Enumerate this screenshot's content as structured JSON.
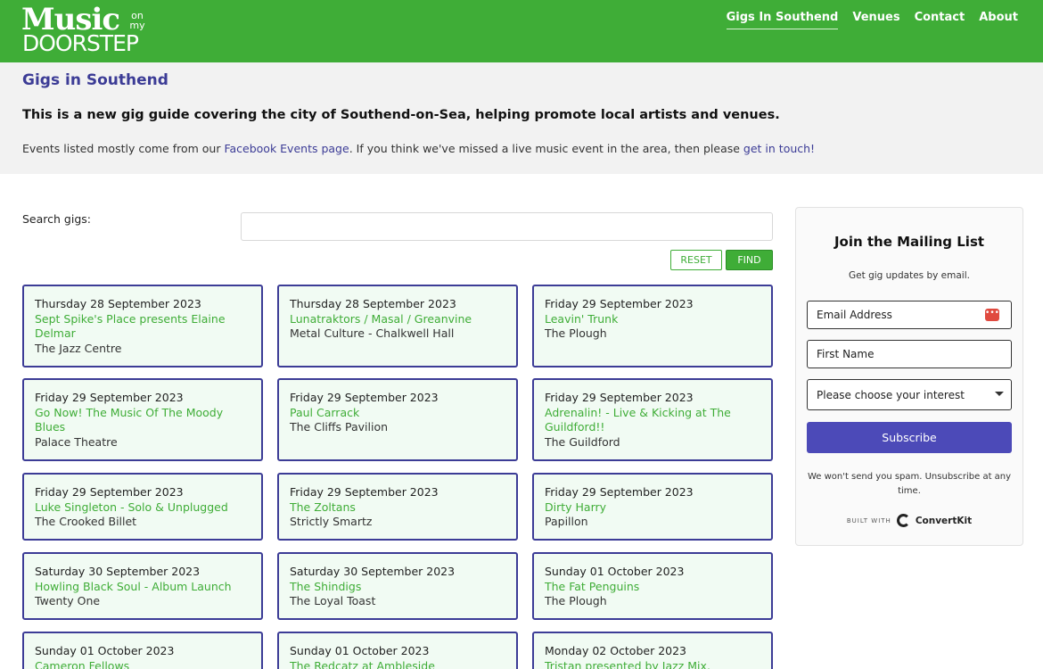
{
  "header": {
    "logo": {
      "line1": "Music",
      "line1_small": "on my",
      "line2": "DOORSTEP"
    },
    "nav": [
      {
        "label": "Gigs In Southend",
        "active": true
      },
      {
        "label": "Venues",
        "active": false
      },
      {
        "label": "Contact",
        "active": false
      },
      {
        "label": "About",
        "active": false
      }
    ]
  },
  "intro": {
    "title": "Gigs in Southend",
    "lead": "This is a new gig guide covering the city of Southend-on-Sea, helping promote local artists and venues.",
    "sub_pre": "Events listed mostly come from our ",
    "sub_link1": "Facebook Events page",
    "sub_mid": ". If you think we've missed a live music event in the area, then please ",
    "sub_link2": "get in touch!"
  },
  "search": {
    "label": "Search gigs:",
    "value": "",
    "reset_label": "RESET",
    "find_label": "FIND"
  },
  "gigs": [
    {
      "date": "Thursday 28 September 2023",
      "title": "Sept Spike's Place presents Elaine Delmar",
      "venue": "The Jazz Centre"
    },
    {
      "date": "Thursday 28 September 2023",
      "title": "Lunatraktors / Masal / Greanvine",
      "venue": "Metal Culture - Chalkwell Hall"
    },
    {
      "date": "Friday 29 September 2023",
      "title": "Leavin' Trunk",
      "venue": "The Plough"
    },
    {
      "date": "Friday 29 September 2023",
      "title": "Go Now! The Music Of The Moody Blues",
      "venue": "Palace Theatre"
    },
    {
      "date": "Friday 29 September 2023",
      "title": "Paul Carrack",
      "venue": "The Cliffs Pavilion"
    },
    {
      "date": "Friday 29 September 2023",
      "title": "Adrenalin! - Live & Kicking at The Guildford!!",
      "venue": "The Guildford"
    },
    {
      "date": "Friday 29 September 2023",
      "title": "Luke Singleton - Solo & Unplugged",
      "venue": "The Crooked Billet"
    },
    {
      "date": "Friday 29 September 2023",
      "title": "The Zoltans",
      "venue": "Strictly Smartz"
    },
    {
      "date": "Friday 29 September 2023",
      "title": "Dirty Harry",
      "venue": "Papillon"
    },
    {
      "date": "Saturday 30 September 2023",
      "title": "Howling Black Soul - Album Launch",
      "venue": "Twenty One"
    },
    {
      "date": "Saturday 30 September 2023",
      "title": "The Shindigs",
      "venue": "The Loyal Toast"
    },
    {
      "date": "Sunday 01 October 2023",
      "title": "The Fat Penguins",
      "venue": "The Plough"
    },
    {
      "date": "Sunday 01 October 2023",
      "title": "Cameron Fellows",
      "venue": ""
    },
    {
      "date": "Sunday 01 October 2023",
      "title": "The Redcatz at Ambleside",
      "venue": ""
    },
    {
      "date": "Monday 02 October 2023",
      "title": "Tristan presented by Jazz Mix, Southend",
      "venue": ""
    }
  ],
  "mailing": {
    "title": "Join the Mailing List",
    "tagline": "Get gig updates by email.",
    "email_placeholder": "Email Address",
    "first_name_placeholder": "First Name",
    "interest_selected": "Please choose your interest",
    "subscribe_label": "Subscribe",
    "spam_note": "We won't send you spam. Unsubscribe at any time.",
    "built_with": "BUILT WITH",
    "provider": "ConvertKit"
  },
  "colors": {
    "brand_green": "#3fad37",
    "brand_purple": "#3c3c96",
    "button_purple": "#4c4ab8",
    "card_bg": "#f1fbf3"
  },
  "icons": [
    "password-manager-icon",
    "chevron-down-icon",
    "convertkit-logo-icon"
  ]
}
